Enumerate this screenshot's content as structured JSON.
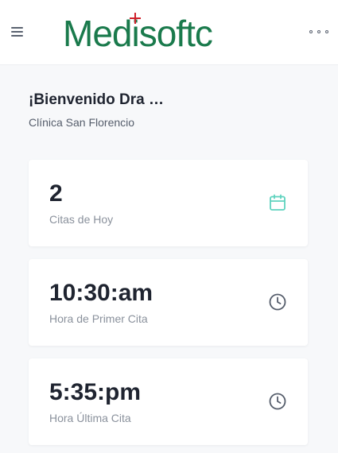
{
  "header": {
    "logo_text": "Medisoftc",
    "menu_icon": "hamburger-menu-icon",
    "more_icon": "more-horizontal-icon"
  },
  "welcome": {
    "title": "¡Bienvenido Dra …",
    "clinic": "Clínica San Florencio"
  },
  "cards": [
    {
      "value": "2",
      "label": "Citas de Hoy",
      "icon": "calendar-icon",
      "icon_color": "#5fd3bf"
    },
    {
      "value": "10:30:am",
      "label": "Hora de Primer Cita",
      "icon": "clock-icon",
      "icon_color": "#555d6b"
    },
    {
      "value": "5:35:pm",
      "label": "Hora Última Cita",
      "icon": "clock-icon",
      "icon_color": "#555d6b"
    }
  ],
  "colors": {
    "brand_green": "#1a7a4c",
    "brand_red": "#d0202a",
    "accent_teal": "#5fd3bf"
  }
}
